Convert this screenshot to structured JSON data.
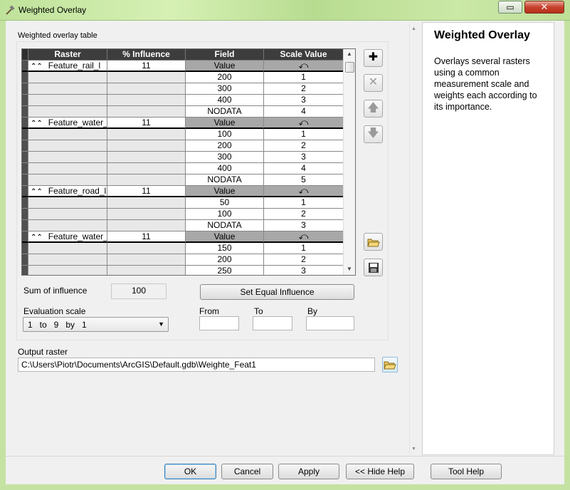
{
  "window": {
    "title": "Weighted Overlay",
    "close_glyph": "✕",
    "help_glyph": "▭"
  },
  "table": {
    "label": "Weighted overlay table",
    "headers": [
      "Raster",
      "% Influence",
      "Field",
      "Scale Value"
    ],
    "groups": [
      {
        "raster": "Feature_rail_l",
        "influence": "11",
        "field": "Value",
        "rows": [
          [
            "200",
            "1"
          ],
          [
            "300",
            "2"
          ],
          [
            "400",
            "3"
          ],
          [
            "NODATA",
            "4"
          ]
        ]
      },
      {
        "raster": "Feature_water_a",
        "influence": "11",
        "field": "Value",
        "rows": [
          [
            "100",
            "1"
          ],
          [
            "200",
            "2"
          ],
          [
            "300",
            "3"
          ],
          [
            "400",
            "4"
          ],
          [
            "NODATA",
            "5"
          ]
        ]
      },
      {
        "raster": "Feature_road_l",
        "influence": "11",
        "field": "Value",
        "rows": [
          [
            "50",
            "1"
          ],
          [
            "100",
            "2"
          ],
          [
            "NODATA",
            "3"
          ]
        ]
      },
      {
        "raster": "Feature_water_l",
        "influence": "11",
        "field": "Value",
        "rows": [
          [
            "150",
            "1"
          ],
          [
            "200",
            "2"
          ],
          [
            "250",
            "3"
          ]
        ]
      }
    ]
  },
  "sum": {
    "label": "Sum of influence",
    "value": "100"
  },
  "set_equal_button": "Set Equal Influence",
  "evaluation": {
    "label": "Evaluation scale",
    "value": "1   to   9   by   1",
    "from_label": "From",
    "to_label": "To",
    "by_label": "By"
  },
  "output": {
    "label": "Output raster",
    "value": "C:\\Users\\Piotr\\Documents\\ArcGIS\\Default.gdb\\Weighte_Feat1"
  },
  "buttons": {
    "ok": "OK",
    "cancel": "Cancel",
    "apply": "Apply",
    "hide_help": "<< Hide Help",
    "tool_help": "Tool Help"
  },
  "help": {
    "title": "Weighted Overlay",
    "body": "Overlays several rasters using a common measurement scale and weights each according to its importance."
  },
  "icons": {
    "add": "add-icon",
    "remove": "remove-icon",
    "up": "arrow-up-icon",
    "down": "arrow-down-icon",
    "open": "open-folder-icon",
    "save": "save-icon",
    "expand": "collapse-chevron-icon",
    "undo": "undo-icon"
  }
}
